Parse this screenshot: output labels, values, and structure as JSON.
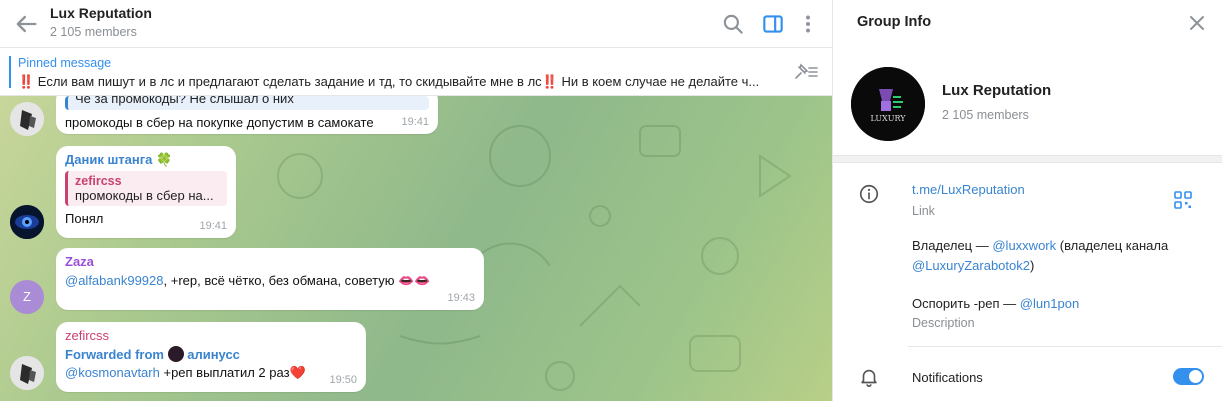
{
  "chat": {
    "title": "Lux Reputation",
    "members": "2 105 members",
    "pinned": {
      "label": "Pinned message",
      "text": "‼️ Если вам пишут и в лс и предлагают сделать задание и тд, то скидывайте мне в лс‼️ Ни в коем случае не делайте ч..."
    },
    "messages": [
      {
        "reply_partial": "Че за промокоды? Не слышал о них",
        "text": "промокоды в сбер на покупке допустим в самокате",
        "time": "19:41"
      },
      {
        "sender": "Даник штанга 🍀",
        "reply_name": "zefircss",
        "reply_text": "промокоды в сбер на...",
        "text": "Понял",
        "time": "19:41"
      },
      {
        "sender": "Zaza",
        "avatar_letter": "Z",
        "mention": "@alfabank99928",
        "text": ", +rep, всё чётко, без обмана, советую",
        "emoji": "👄👄",
        "time": "19:43"
      },
      {
        "sender": "zefircss",
        "forwarded_label": "Forwarded from",
        "forwarded_name": "алинусс",
        "mention": "@kosmonavtarh",
        "text": " +реп выплатил 2 раз",
        "emoji": "❤️",
        "time": "19:50"
      }
    ]
  },
  "info": {
    "title": "Group Info",
    "name": "Lux Reputation",
    "members": "2 105 members",
    "avatar_text": "LUXURY",
    "link": "t.me/LuxReputation",
    "link_label": "Link",
    "desc_line1_a": "Владелец — ",
    "desc_line1_mention": "@luxxwork",
    "desc_line1_b": " (владелец канала",
    "desc_line2_mention": "@LuxuryZarabotok2",
    "desc_line2_b": ")",
    "desc_line3_a": "Оспорить -реп — ",
    "desc_line3_mention": "@lun1pon",
    "desc_label": "Description",
    "notifications": "Notifications",
    "notifications_on": true
  },
  "colors": {
    "accent": "#3390ec",
    "link": "#3a84cf",
    "reply_accent": "#c9426d",
    "sender_purple": "#9c4fd6",
    "sender_blue": "#3a84cf"
  },
  "icons": [
    "back-arrow-icon",
    "search-icon",
    "sidebar-panel-icon",
    "more-vertical-icon",
    "pin-list-icon",
    "close-icon",
    "info-icon",
    "qr-code-icon",
    "bell-icon"
  ]
}
